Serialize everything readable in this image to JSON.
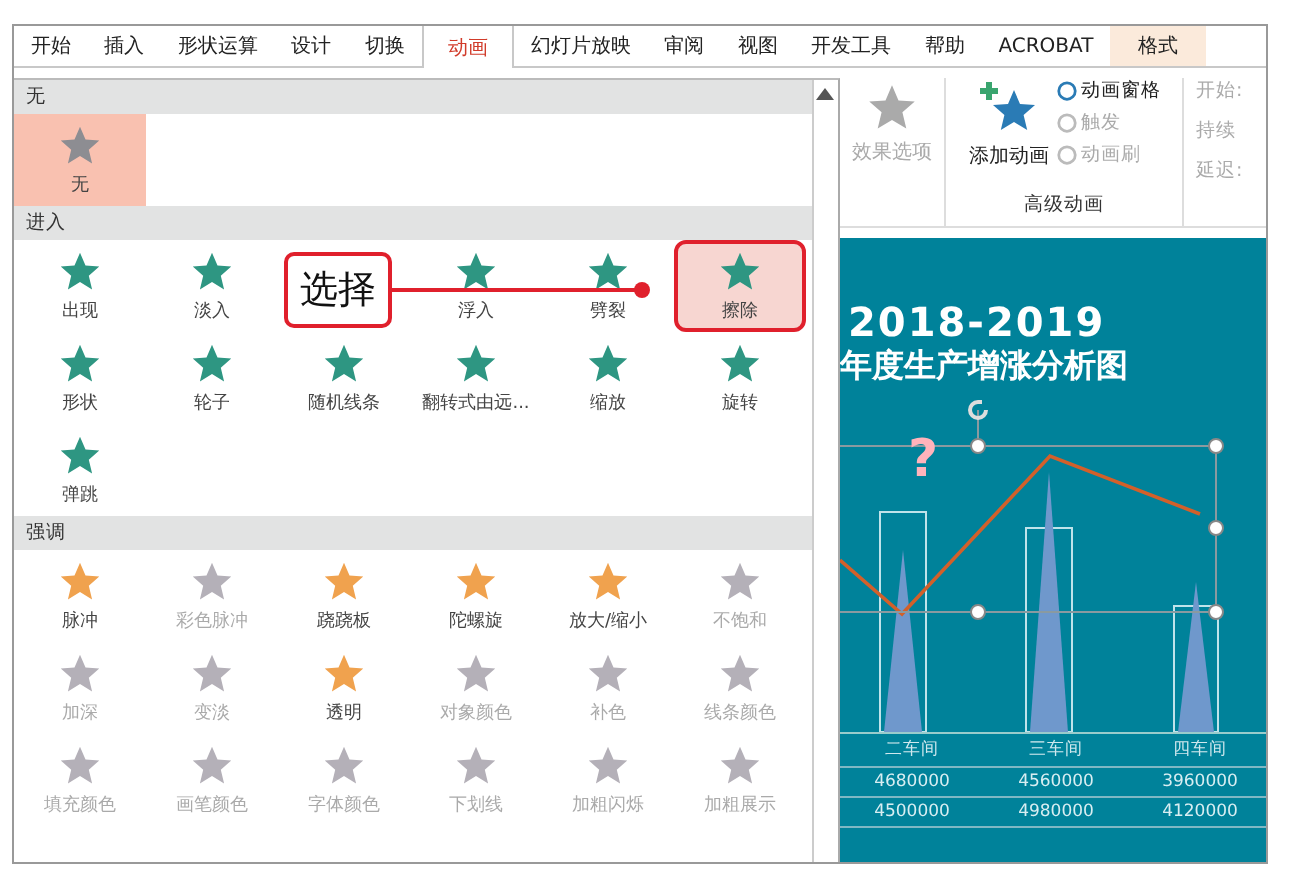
{
  "tabs": [
    {
      "label": "开始",
      "selected": false,
      "kind": "normal"
    },
    {
      "label": "插入",
      "selected": false,
      "kind": "normal"
    },
    {
      "label": "形状运算",
      "selected": false,
      "kind": "normal"
    },
    {
      "label": "设计",
      "selected": false,
      "kind": "normal"
    },
    {
      "label": "切换",
      "selected": false,
      "kind": "normal"
    },
    {
      "label": "动画",
      "selected": true,
      "kind": "normal"
    },
    {
      "label": "幻灯片放映",
      "selected": false,
      "kind": "normal"
    },
    {
      "label": "审阅",
      "selected": false,
      "kind": "normal"
    },
    {
      "label": "视图",
      "selected": false,
      "kind": "normal"
    },
    {
      "label": "开发工具",
      "selected": false,
      "kind": "normal"
    },
    {
      "label": "帮助",
      "selected": false,
      "kind": "normal"
    },
    {
      "label": "ACROBAT",
      "selected": false,
      "kind": "normal"
    },
    {
      "label": "格式",
      "selected": false,
      "kind": "contextual"
    }
  ],
  "gallery": {
    "sections": [
      {
        "title": "无",
        "kind": "none",
        "items": [
          {
            "label": "无",
            "kind": "effect",
            "selected": true,
            "hovered": false,
            "disabled": false
          }
        ]
      },
      {
        "title": "进入",
        "kind": "entrance",
        "items": [
          {
            "label": "出现",
            "kind": "effect",
            "selected": false,
            "hovered": false,
            "disabled": false
          },
          {
            "label": "淡入",
            "kind": "effect",
            "selected": false,
            "hovered": false,
            "disabled": false
          },
          {
            "kind": "covered"
          },
          {
            "label": "浮入",
            "kind": "effect",
            "selected": false,
            "hovered": false,
            "disabled": false
          },
          {
            "label": "劈裂",
            "kind": "effect",
            "selected": false,
            "hovered": false,
            "disabled": false
          },
          {
            "label": "擦除",
            "kind": "effect",
            "selected": false,
            "hovered": true,
            "disabled": false
          },
          {
            "label": "形状",
            "kind": "effect",
            "selected": false,
            "hovered": false,
            "disabled": false
          },
          {
            "label": "轮子",
            "kind": "effect",
            "selected": false,
            "hovered": false,
            "disabled": false
          },
          {
            "label": "随机线条",
            "kind": "effect",
            "selected": false,
            "hovered": false,
            "disabled": false
          },
          {
            "label": "翻转式由远...",
            "kind": "effect",
            "selected": false,
            "hovered": false,
            "disabled": false
          },
          {
            "label": "缩放",
            "kind": "effect",
            "selected": false,
            "hovered": false,
            "disabled": false
          },
          {
            "label": "旋转",
            "kind": "effect",
            "selected": false,
            "hovered": false,
            "disabled": false
          },
          {
            "label": "弹跳",
            "kind": "effect",
            "selected": false,
            "hovered": false,
            "disabled": false
          }
        ]
      },
      {
        "title": "强调",
        "kind": "emphasis",
        "items": [
          {
            "label": "脉冲",
            "kind": "effect",
            "selected": false,
            "hovered": false,
            "disabled": false
          },
          {
            "label": "彩色脉冲",
            "kind": "effect",
            "selected": false,
            "hovered": false,
            "disabled": true
          },
          {
            "label": "跷跷板",
            "kind": "effect",
            "selected": false,
            "hovered": false,
            "disabled": false
          },
          {
            "label": "陀螺旋",
            "kind": "effect",
            "selected": false,
            "hovered": false,
            "disabled": false
          },
          {
            "label": "放大/缩小",
            "kind": "effect",
            "selected": false,
            "hovered": false,
            "disabled": false
          },
          {
            "label": "不饱和",
            "kind": "effect",
            "selected": false,
            "hovered": false,
            "disabled": true
          },
          {
            "label": "加深",
            "kind": "effect",
            "selected": false,
            "hovered": false,
            "disabled": true
          },
          {
            "label": "变淡",
            "kind": "effect",
            "selected": false,
            "hovered": false,
            "disabled": true
          },
          {
            "label": "透明",
            "kind": "effect",
            "selected": false,
            "hovered": false,
            "disabled": false
          },
          {
            "label": "对象颜色",
            "kind": "effect",
            "selected": false,
            "hovered": false,
            "disabled": true
          },
          {
            "label": "补色",
            "kind": "effect",
            "selected": false,
            "hovered": false,
            "disabled": true
          },
          {
            "label": "线条颜色",
            "kind": "effect",
            "selected": false,
            "hovered": false,
            "disabled": true
          },
          {
            "label": "填充颜色",
            "kind": "effect",
            "selected": false,
            "hovered": false,
            "disabled": true
          },
          {
            "label": "画笔颜色",
            "kind": "effect",
            "selected": false,
            "hovered": false,
            "disabled": true
          },
          {
            "label": "字体颜色",
            "kind": "effect",
            "selected": false,
            "hovered": false,
            "disabled": true
          },
          {
            "label": "下划线",
            "kind": "effect",
            "selected": false,
            "hovered": false,
            "disabled": true
          },
          {
            "label": "加粗闪烁",
            "kind": "effect",
            "selected": false,
            "hovered": false,
            "disabled": true
          },
          {
            "label": "加粗展示",
            "kind": "effect",
            "selected": false,
            "hovered": false,
            "disabled": true
          }
        ]
      }
    ]
  },
  "callout": {
    "text": "选择"
  },
  "ribbon": {
    "effect_options": {
      "label": "效果选项",
      "disabled": true
    },
    "add_animation": {
      "label": "添加动画"
    },
    "small_buttons": [
      {
        "label": "动画窗格",
        "disabled": false
      },
      {
        "label": "触发",
        "disabled": true
      },
      {
        "label": "动画刷",
        "disabled": true
      }
    ],
    "group_label": "高级动画",
    "timing": [
      {
        "label": "开始:"
      },
      {
        "label": "持续"
      },
      {
        "label": "延迟:"
      }
    ]
  },
  "slide": {
    "title": "2018-2019",
    "subtitle": "年度生产增涨分析图",
    "question_mark": "?",
    "table": {
      "header": [
        "二车间",
        "三车间",
        "四车间"
      ],
      "rows": [
        [
          "4680000",
          "4560000",
          "3960000"
        ],
        [
          "4500000",
          "4980000",
          "4120000"
        ]
      ]
    }
  }
}
